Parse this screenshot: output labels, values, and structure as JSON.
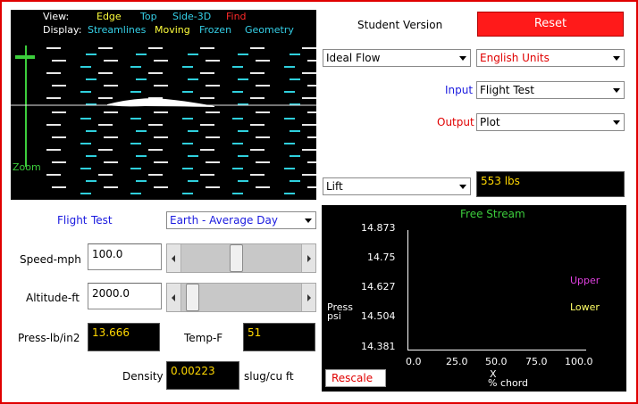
{
  "view": {
    "view_label": "View:",
    "view_edge": "Edge",
    "view_top": "Top",
    "view_side3d": "Side-3D",
    "view_find": "Find",
    "display_label": "Display:",
    "display_streamlines": "Streamlines",
    "display_moving": "Moving",
    "display_frozen": "Frozen",
    "display_geometry": "Geometry",
    "zoom_label": "Zoom"
  },
  "header": {
    "version_label": "Student Version",
    "reset_label": "Reset"
  },
  "selectors": {
    "flow_type": "Ideal Flow",
    "units": "English Units",
    "input_label": "Input",
    "input_value": "Flight Test",
    "output_label": "Output",
    "output_value": "Plot",
    "lift_select": "Lift",
    "lift_value": "553 lbs"
  },
  "flight": {
    "flight_label": "Flight",
    "test_label": "Test",
    "planet": "Earth - Average Day",
    "speed_label": "Speed-mph",
    "speed_value": "100.0",
    "speed_slider_fraction": 0.45,
    "altitude_label": "Altitude-ft",
    "altitude_value": "2000.0",
    "altitude_slider_fraction": 0.04,
    "press_label": "Press-lb/in2",
    "press_value": "13.666",
    "temp_label": "Temp-F",
    "temp_value": "51",
    "density_label": "Density",
    "density_value": "0.00223",
    "density_unit": "slug/cu ft"
  },
  "plot": {
    "title": "Free Stream",
    "ylabel_line1": "Press",
    "ylabel_line2": "psi",
    "y_ticks": [
      "14.873",
      "14.75",
      "14.627",
      "14.504",
      "14.381"
    ],
    "x_ticks": [
      "0.0",
      "25.0",
      "50.0",
      "75.0",
      "100.0"
    ],
    "xlabel_line1": "X",
    "xlabel_line2": "% chord",
    "legend_upper": "Upper",
    "legend_lower": "Lower",
    "rescale_label": "Rescale",
    "colors": {
      "upper": "#e040e0",
      "lower": "#ffff66",
      "title": "#3ccd3c"
    }
  }
}
